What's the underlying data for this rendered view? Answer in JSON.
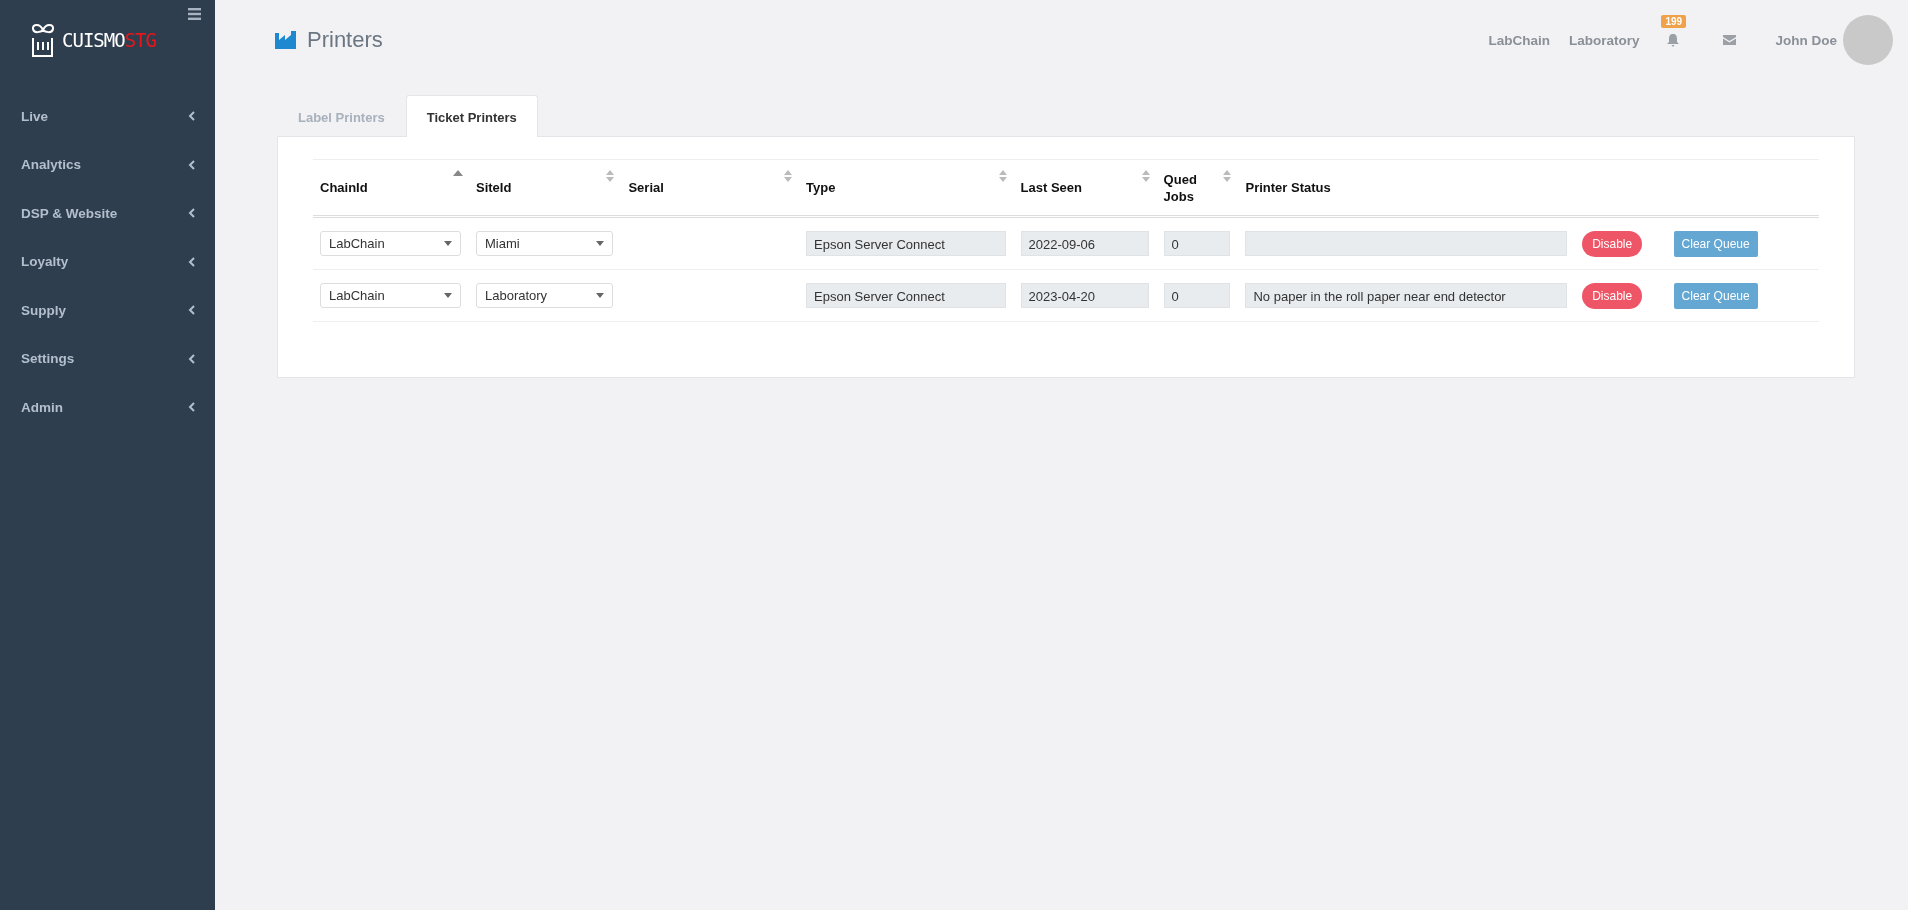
{
  "sidebar": {
    "logo": {
      "text": "CUISMO",
      "suffix": "STG"
    },
    "items": [
      {
        "label": "Live"
      },
      {
        "label": "Analytics"
      },
      {
        "label": "DSP & Website"
      },
      {
        "label": "Loyalty"
      },
      {
        "label": "Supply"
      },
      {
        "label": "Settings"
      },
      {
        "label": "Admin"
      }
    ]
  },
  "header": {
    "title": "Printers",
    "links": [
      "LabChain",
      "Laboratory"
    ],
    "notification_count": "199",
    "user_name": "John Doe"
  },
  "tabs": [
    {
      "label": "Label Printers",
      "selected": false
    },
    {
      "label": "Ticket Printers",
      "selected": true
    }
  ],
  "table": {
    "columns": [
      {
        "label": "ChainId",
        "sortable": true,
        "sorted": true
      },
      {
        "label": "SiteId",
        "sortable": true,
        "sorted": false
      },
      {
        "label": "Serial",
        "sortable": true,
        "sorted": false
      },
      {
        "label": "Type",
        "sortable": true,
        "sorted": false
      },
      {
        "label": "Last Seen",
        "sortable": true,
        "sorted": false
      },
      {
        "label": "Qued Jobs",
        "sortable": true,
        "sorted": false
      },
      {
        "label": "Printer Status",
        "sortable": false,
        "sorted": false
      },
      {
        "sortable": false,
        "sorted": false
      },
      {
        "sortable": false,
        "sorted": false
      }
    ],
    "rows": [
      {
        "cells": [
          {
            "kind": "select",
            "value": "LabChain"
          },
          {
            "kind": "select",
            "value": "Miami"
          },
          {
            "kind": "empty"
          },
          {
            "kind": "readonly",
            "value": "Epson Server Connect"
          },
          {
            "kind": "readonly",
            "value": "2022-09-06"
          },
          {
            "kind": "readonly",
            "value": "0"
          },
          {
            "kind": "readonly"
          },
          {
            "kind": "danger",
            "label": "Disable"
          },
          {
            "kind": "info",
            "label": "Clear Queue"
          }
        ]
      },
      {
        "cells": [
          {
            "kind": "select",
            "value": "LabChain"
          },
          {
            "kind": "select",
            "value": "Laboratory"
          },
          {
            "kind": "empty"
          },
          {
            "kind": "readonly",
            "value": "Epson Server Connect"
          },
          {
            "kind": "readonly",
            "value": "2023-04-20"
          },
          {
            "kind": "readonly",
            "value": "0"
          },
          {
            "kind": "readonly",
            "value": "No paper in the roll paper near end detector"
          },
          {
            "kind": "danger",
            "label": "Disable"
          },
          {
            "kind": "info",
            "label": "Clear Queue"
          }
        ]
      }
    ]
  }
}
